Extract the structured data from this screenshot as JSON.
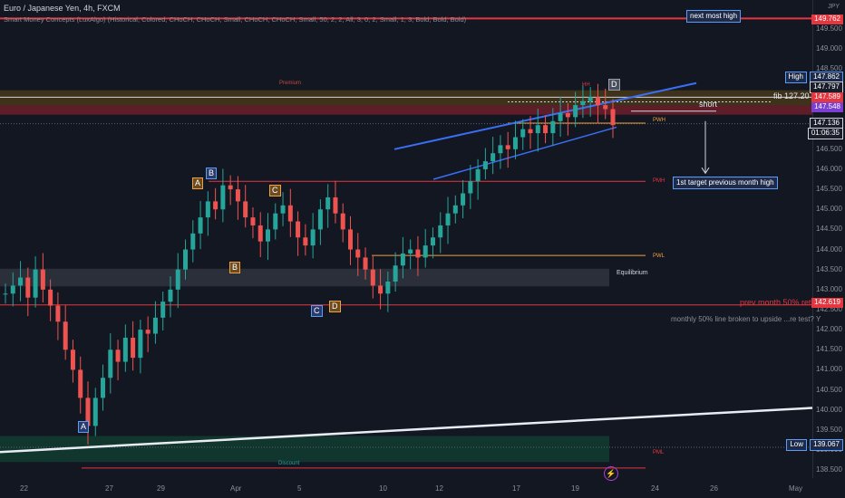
{
  "header": {
    "title": "Euro / Japanese Yen, 4h, FXCM",
    "indicator": "Smart Money Concepts (LuxAlgo) (Historical, Colored, CHoCH, CHoCH, Small, CHoCH, CHoCH, Small, 50, 2, 2, All, 3, 0, 2, Small, 1, 3, Bold, Bold, Bold)"
  },
  "currency": "JPY",
  "price_scale": {
    "ticks": [
      "149.500",
      "149.000",
      "148.500",
      "148.000",
      "147.500",
      "147.000",
      "146.500",
      "146.000",
      "145.500",
      "145.000",
      "144.500",
      "144.000",
      "143.500",
      "143.000",
      "142.500",
      "142.000",
      "141.500",
      "141.000",
      "140.500",
      "140.000",
      "139.500",
      "139.000",
      "138.500"
    ],
    "tags": [
      {
        "key": "nmh",
        "text": "149.762",
        "color": "#e5373f"
      },
      {
        "key": "high_label",
        "text": "High",
        "color": "#1e2a49"
      },
      {
        "key": "high",
        "text": "147.862",
        "color": "#1e2a49"
      },
      {
        "key": "p797",
        "text": "147.797",
        "color": "#1a1e2a"
      },
      {
        "key": "p589",
        "text": "147.589",
        "color": "#e5373f"
      },
      {
        "key": "p548",
        "text": "147.548",
        "color": "#7b3fd1"
      },
      {
        "key": "last",
        "text": "147.136",
        "color": "#1a1e2a"
      },
      {
        "key": "timer",
        "text": "01:06:35",
        "color": "#1a1e2a"
      },
      {
        "key": "pmr",
        "text": "142.619",
        "color": "#e5373f"
      },
      {
        "key": "low_label",
        "text": "Low",
        "color": "#1e2a49"
      },
      {
        "key": "low",
        "text": "139.067",
        "color": "#1e2a49"
      }
    ]
  },
  "time_axis": [
    "22",
    "27",
    "29",
    "Apr",
    "5",
    "10",
    "12",
    "17",
    "19",
    "24",
    "26",
    "May"
  ],
  "annotations": {
    "next_most_high": "next most high",
    "fib": "fib 127.20",
    "short": "short",
    "first_target": "1st target previous month high",
    "prev_month": "prev month 50% ret",
    "monthly_note": "monthly 50%  line broken to upside ...re test? Y",
    "equilibrium": "Equilibrium",
    "premium": "Premium",
    "discount": "Discount",
    "pwh": "PWH",
    "pwl": "PWL",
    "pmh": "PMH",
    "pml": "PML",
    "hh": "HH",
    "points": {
      "A": "A",
      "B": "B",
      "C": "C",
      "D": "D"
    }
  },
  "colors": {
    "bg": "#131722",
    "up": "#26a69a",
    "down": "#ef5350",
    "red_line": "#e5373f",
    "blue": "#3a6ef5",
    "orange": "#f0a040"
  },
  "chart_data": {
    "type": "candlestick",
    "symbol": "EURJPY",
    "timeframe": "4h",
    "ylim": [
      138.3,
      149.95
    ],
    "levels": {
      "next_most_high": 149.762,
      "high": 147.862,
      "fib_127": 147.797,
      "premium_top": 147.589,
      "premium_bottom": 147.548,
      "last_price": 147.136,
      "pmh": 145.7,
      "pwl": 143.85,
      "equilibrium": 143.3,
      "prev_month_50": 142.619,
      "low": 139.067
    },
    "pattern_points": [
      {
        "name": "A",
        "price": 139.2
      },
      {
        "name": "B",
        "price": 145.8
      },
      {
        "name": "C",
        "price": 142.7
      },
      {
        "name": "D",
        "price": 147.9
      }
    ],
    "candles_close_path": [
      142.9,
      143.1,
      143.3,
      142.8,
      143.5,
      143.0,
      142.6,
      142.2,
      141.5,
      141.0,
      140.3,
      139.6,
      140.3,
      140.8,
      141.5,
      141.2,
      141.8,
      141.3,
      142.0,
      141.9,
      142.3,
      142.7,
      143.0,
      143.5,
      144.0,
      144.4,
      144.8,
      145.2,
      145.0,
      145.6,
      145.5,
      145.2,
      144.8,
      144.6,
      144.2,
      144.5,
      144.9,
      145.1,
      144.7,
      144.3,
      144.1,
      144.5,
      145.0,
      145.3,
      144.9,
      144.5,
      144.0,
      143.8,
      143.5,
      143.1,
      142.9,
      143.2,
      143.6,
      143.9,
      144.0,
      143.8,
      144.1,
      144.3,
      144.6,
      144.9,
      145.1,
      145.4,
      145.7,
      146.0,
      146.2,
      146.4,
      146.6,
      146.5,
      146.8,
      147.0,
      146.9,
      147.1,
      146.9,
      147.2,
      147.4,
      147.3,
      147.6,
      147.7,
      147.8,
      147.6,
      147.5,
      147.1
    ]
  }
}
